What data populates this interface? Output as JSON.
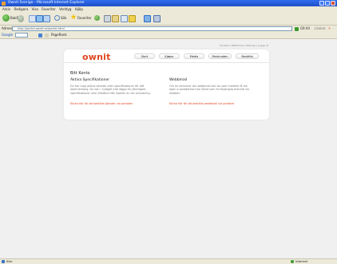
{
  "window": {
    "title": "Ownit Sverige - Microsoft Internet Explorer"
  },
  "menubar": {
    "items": [
      "Arkiv",
      "Redigera",
      "Visa",
      "Favoriter",
      "Verktyg",
      "Hjälp"
    ]
  },
  "toolbar": {
    "back_label": "Bakåt",
    "search_label": "Sök",
    "favorites_label": "Favoriter",
    "go_label": "Gå till",
    "links_label": "Länkar"
  },
  "addressbar": {
    "label": "Adress",
    "value": "http://portal.ownit.se/portal.html"
  },
  "googlebar": {
    "label": "Google",
    "extra": "PageRank"
  },
  "page": {
    "toplinks": "Kontakt | Webbmail | Sitemap | Logga ut",
    "logo": "ownit",
    "nav": [
      "Start",
      "Kjøpsr",
      "Media",
      "Marknaden",
      "Beställa"
    ],
    "heading": "Bitt Konto",
    "left": {
      "title": "Aktiva Specifikationer",
      "body": "Du har inga aktiva tjänster eller specifikationer för ditt abonnemang. Du kan i nuläget inte lägga till ytterligare specifikationer utan tillstånd från ägaren av din anslutning.",
      "link": "Klicka här för att beställa tjänster via portalen"
    },
    "right": {
      "title": "Webbmail",
      "body": "Om du aktiverar din webbmail kan du som medlem få din egen e-postadress hos Ownit som är tillgänglig överallt via webben.",
      "link": "Klicka här för att beställa webbmail via portalen"
    }
  },
  "status": {
    "left": "Klar",
    "right": "Internet"
  }
}
